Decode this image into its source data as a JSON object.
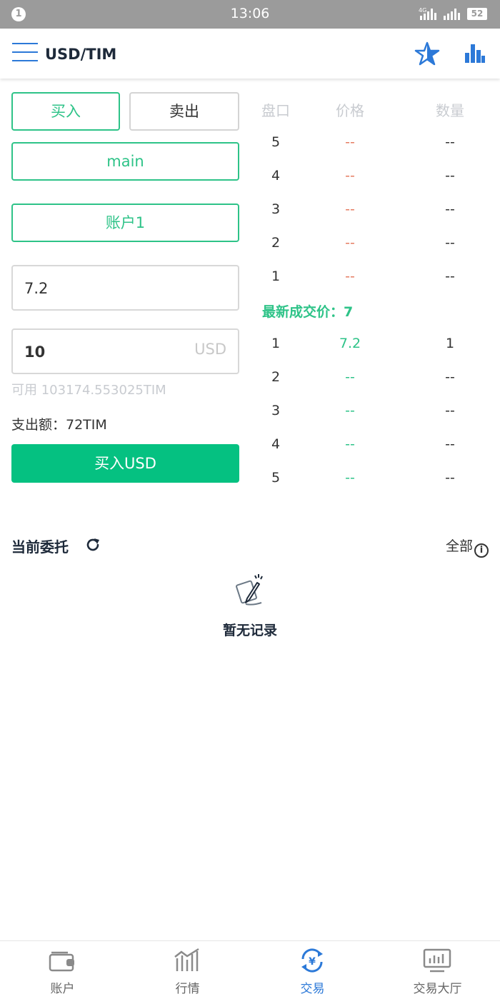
{
  "status_bar": {
    "notification": "1",
    "time": "13:06",
    "network_1": "4G",
    "battery": "52"
  },
  "header": {
    "title": "USD/TIM"
  },
  "form": {
    "buy_tab": "买入",
    "sell_tab": "卖出",
    "account_type": "main",
    "account_name": "账户1",
    "price_value": "7.2",
    "amount_value": "10",
    "amount_unit": "USD",
    "available": "可用 103174.553025TIM",
    "cost": "支出额：72TIM",
    "submit": "买入USD"
  },
  "orderbook": {
    "headers": {
      "level": "盘口",
      "price": "价格",
      "qty": "数量"
    },
    "asks": [
      {
        "level": "5",
        "price": "--",
        "qty": "--"
      },
      {
        "level": "4",
        "price": "--",
        "qty": "--"
      },
      {
        "level": "3",
        "price": "--",
        "qty": "--"
      },
      {
        "level": "2",
        "price": "--",
        "qty": "--"
      },
      {
        "level": "1",
        "price": "--",
        "qty": "--"
      }
    ],
    "latest_price": "最新成交价：7",
    "bids": [
      {
        "level": "1",
        "price": "7.2",
        "qty": "1"
      },
      {
        "level": "2",
        "price": "--",
        "qty": "--"
      },
      {
        "level": "3",
        "price": "--",
        "qty": "--"
      },
      {
        "level": "4",
        "price": "--",
        "qty": "--"
      },
      {
        "level": "5",
        "price": "--",
        "qty": "--"
      }
    ]
  },
  "orders": {
    "title": "当前委托",
    "all": "全部",
    "empty": "暂无记录"
  },
  "nav": [
    {
      "label": "账户",
      "icon": "wallet-icon"
    },
    {
      "label": "行情",
      "icon": "market-chart-icon"
    },
    {
      "label": "交易",
      "icon": "trade-yen-icon",
      "active": true
    },
    {
      "label": "交易大厅",
      "icon": "trading-hall-icon"
    }
  ],
  "colors": {
    "accent_green": "#2ec388",
    "submit_green": "#05c181",
    "brand_blue": "#2c79d8",
    "ask_red": "#e57b60"
  }
}
